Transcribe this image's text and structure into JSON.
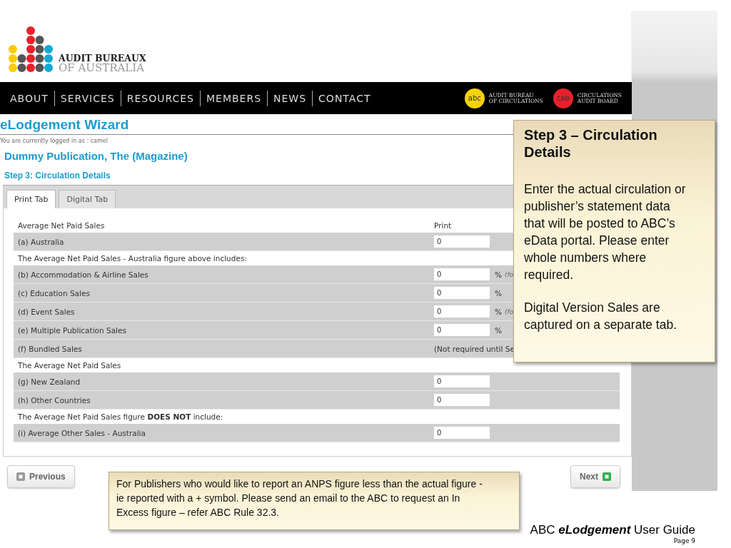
{
  "logo": {
    "line1": "AUDIT BUREAUX",
    "line2": "OF AUSTRALIA"
  },
  "nav": [
    "ABOUT",
    "SERVICES",
    "RESOURCES",
    "MEMBERS",
    "NEWS",
    "CONTACT"
  ],
  "partners": [
    {
      "badge": "abc",
      "color": "#f5d10a",
      "lines": [
        "AUDIT BUREAU",
        "OF CIRCULATIONS"
      ]
    },
    {
      "badge": "cab",
      "color": "#e8202a",
      "lines": [
        "CIRCULATIONS",
        "AUDIT BOARD"
      ]
    }
  ],
  "page_title": "eLodgement Wizard",
  "login_note": "You are currently logged in as : camel",
  "publication": "Dummy Publication, The (Magazine)",
  "step": "Step 3: Circulation Details",
  "tabs": [
    {
      "label": "Print Tab",
      "selected": true
    },
    {
      "label": "Digital Tab",
      "selected": false
    }
  ],
  "rows": [
    {
      "kind": "header",
      "label": "Average Net Paid Sales",
      "column": "Print"
    },
    {
      "kind": "item",
      "label": "(a) Australia",
      "value": "0"
    },
    {
      "kind": "section",
      "label": "The Average Net Paid Sales - Australia figure above includes:"
    },
    {
      "kind": "item",
      "label": "(b) Accommodation & Airline Sales",
      "value": "0",
      "unit": "%",
      "note": "(fo"
    },
    {
      "kind": "item",
      "label": "(c) Education Sales",
      "value": "0",
      "unit": "%"
    },
    {
      "kind": "item",
      "label": "(d) Event Sales",
      "value": "0",
      "unit": "%",
      "note": "(fo"
    },
    {
      "kind": "item",
      "label": "(e) Multiple Publication Sales",
      "value": "0",
      "unit": "%"
    },
    {
      "kind": "item",
      "label": "(f) Bundled Sales",
      "text": "(Not required until Se"
    },
    {
      "kind": "section",
      "label": "The Average Net Paid Sales"
    },
    {
      "kind": "item",
      "label": "(g) New Zealand",
      "value": "0"
    },
    {
      "kind": "item",
      "label": "(h) Other Countries",
      "value": "0"
    },
    {
      "kind": "section",
      "label": "The Average Net Paid Sales figure **DOES NOT** include:"
    },
    {
      "kind": "item",
      "label": "(i) Average Other Sales - Australia",
      "value": "0"
    }
  ],
  "buttons": {
    "previous": "Previous",
    "next": "Next"
  },
  "callouts": [
    {
      "title": "Step 3 – Circulation Details",
      "paragraphs": [
        "Enter the actual circulation or publisher’s statement data that will be posted to ABC’s eData portal. Please enter whole numbers where required.",
        "Digital Version Sales are captured  on a separate tab."
      ]
    },
    {
      "paragraphs": [
        "For Publishers who would like to report an ANPS figure less than the actual figure -ie reported with a + symbol. Please send an email to the ABC to request an In Excess figure – refer ABC Rule 32.3."
      ]
    }
  ],
  "footer": {
    "title": "ABC **eLodgement** User Guide",
    "page": "Page 9"
  }
}
